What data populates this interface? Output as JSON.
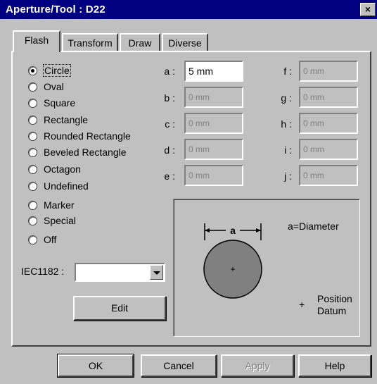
{
  "window": {
    "title": "Aperture/Tool : D22",
    "close_label": "×"
  },
  "tabs": [
    "Flash",
    "Transform",
    "Draw",
    "Diverse"
  ],
  "shapes": [
    "Circle",
    "Oval",
    "Square",
    "Rectangle",
    "Rounded Rectangle",
    "Beveled Rectangle",
    "Octagon",
    "Undefined"
  ],
  "extra_shapes": [
    "Marker",
    "Special",
    "Off"
  ],
  "selected_shape": "Circle",
  "fields_left": [
    {
      "label": "a :",
      "value": "5 mm",
      "enabled": true
    },
    {
      "label": "b :",
      "value": "0 mm",
      "enabled": false
    },
    {
      "label": "c :",
      "value": "0 mm",
      "enabled": false
    },
    {
      "label": "d :",
      "value": "0 mm",
      "enabled": false
    },
    {
      "label": "e :",
      "value": "0 mm",
      "enabled": false
    }
  ],
  "fields_right": [
    {
      "label": "f :",
      "value": "0 mm",
      "enabled": false
    },
    {
      "label": "g :",
      "value": "0 mm",
      "enabled": false
    },
    {
      "label": "h :",
      "value": "0 mm",
      "enabled": false
    },
    {
      "label": "i :",
      "value": "0 mm",
      "enabled": false
    },
    {
      "label": "j :",
      "value": "0 mm",
      "enabled": false
    }
  ],
  "iec": {
    "label": "IEC1182 :",
    "value": ""
  },
  "edit_label": "Edit",
  "preview": {
    "dimension_label": "a",
    "legend": "a=Diameter",
    "datum_marker": "+",
    "datum_text_1": "Position",
    "datum_text_2": "Datum"
  },
  "buttons": {
    "ok": "OK",
    "cancel": "Cancel",
    "apply": "Apply",
    "help": "Help"
  },
  "colors": {
    "title_bar": "#000080",
    "face": "#c0c0c0",
    "shape_fill": "#808080"
  }
}
